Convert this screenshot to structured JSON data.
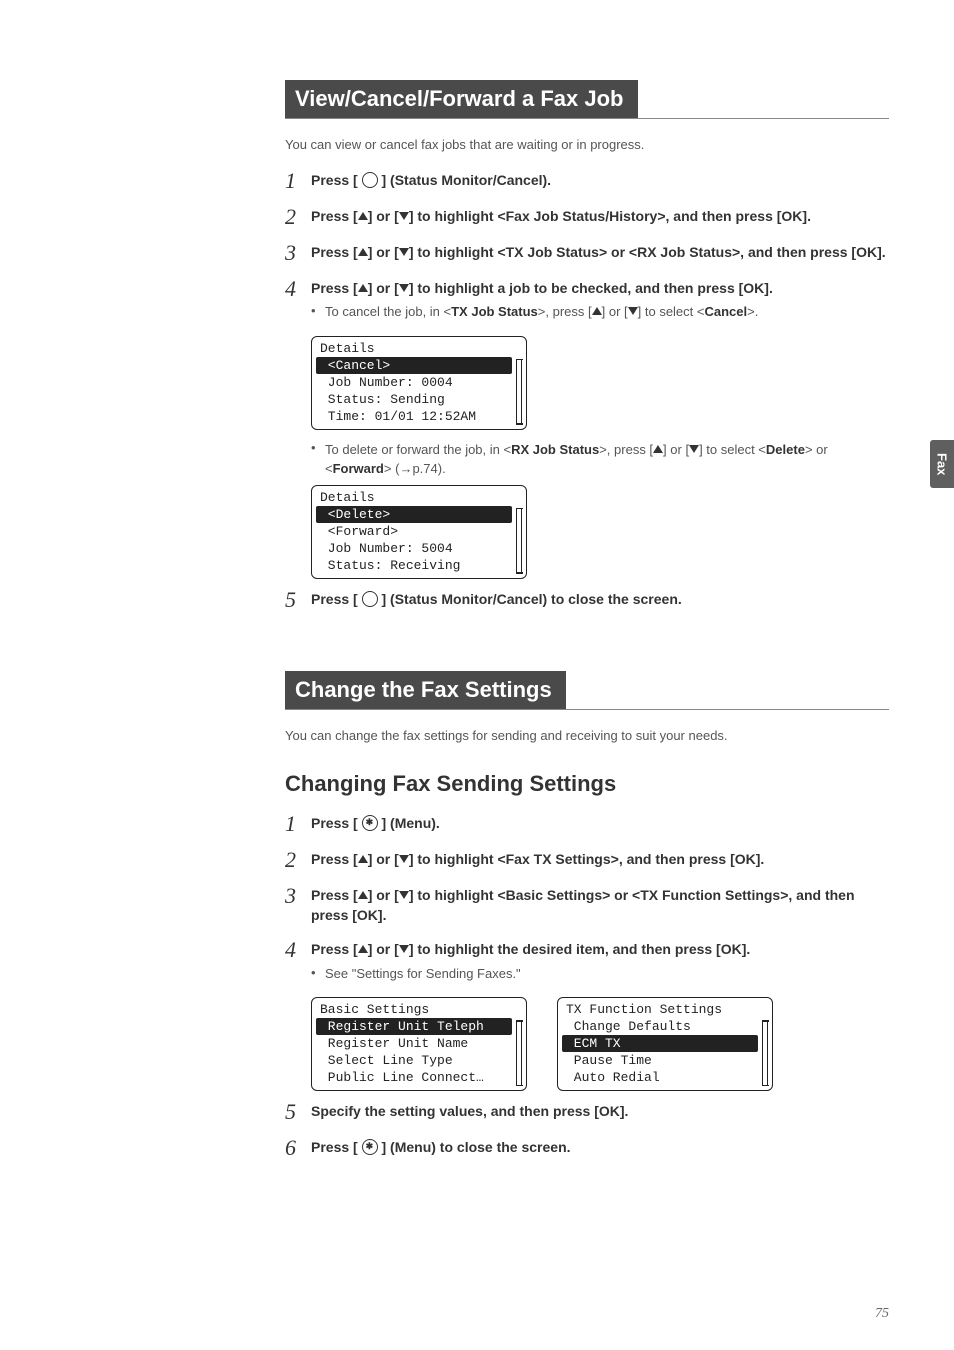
{
  "sideTab": "Fax",
  "pageNumber": "75",
  "section1": {
    "title": "View/Cancel/Forward a Fax Job",
    "intro": "You can view or cancel fax jobs that are waiting or in progress.",
    "steps": {
      "s1": {
        "num": "1",
        "a": "Press [",
        "b": "] (Status Monitor/Cancel)."
      },
      "s2": {
        "num": "2",
        "a": "Press [",
        "mid1": "] or [",
        "mid2": "] to highlight <Fax Job Status/History>, and then press [OK]."
      },
      "s3": {
        "num": "3",
        "a": "Press [",
        "mid1": "] or [",
        "mid2": "] to highlight <TX Job Status> or <RX Job Status>, and then press [OK]."
      },
      "s4": {
        "num": "4",
        "a": "Press [",
        "mid1": "] or [",
        "mid2": "] to highlight a job to be checked, and then press [OK].",
        "bullet1a": "To cancel the job, in <",
        "bullet1b": "TX Job Status",
        "bullet1c": ">, press [",
        "bullet1d": "] or [",
        "bullet1e": "] to select <",
        "bullet1f": "Cancel",
        "bullet1g": ">.",
        "bullet2a": "To delete or forward the job, in <",
        "bullet2b": "RX Job Status",
        "bullet2c": ">, press [",
        "bullet2d": "] or [",
        "bullet2e": "] to select <",
        "bullet2f": "Delete",
        "bullet2g": "> or <",
        "bullet2h": "Forward",
        "bullet2i": "> (",
        "bullet2j": "p.74)."
      },
      "s5": {
        "num": "5",
        "a": "Press [",
        "b": "] (Status Monitor/Cancel) to close the screen."
      }
    },
    "lcd1": {
      "title": "Details",
      "r1": " <Cancel>",
      "r2": " Job Number: 0004",
      "r3": " Status: Sending",
      "r4": " Time: 01/01 12:52AM"
    },
    "lcd2": {
      "title": "Details",
      "r1": " <Delete>",
      "r2": " <Forward>",
      "r3": " Job Number: 5004",
      "r4": " Status: Receiving"
    }
  },
  "section2": {
    "title": "Change the Fax Settings",
    "intro": "You can change the fax settings for sending and receiving to suit your needs.",
    "subheading": "Changing Fax Sending Settings",
    "steps": {
      "s1": {
        "num": "1",
        "a": "Press [",
        "b": "] (Menu)."
      },
      "s2": {
        "num": "2",
        "a": "Press [",
        "mid1": "] or [",
        "mid2": "] to highlight <Fax TX Settings>, and then press [OK]."
      },
      "s3": {
        "num": "3",
        "a": "Press [",
        "mid1": "] or [",
        "mid2": "] to highlight <Basic Settings> or <TX Function Settings>, and then press [OK]."
      },
      "s4": {
        "num": "4",
        "a": "Press [",
        "mid1": "] or [",
        "mid2": "] to highlight the desired item, and then press [OK].",
        "bullet": "See \"Settings for Sending Faxes.\""
      },
      "s5": {
        "num": "5",
        "text": "Specify the setting values, and then press [OK]."
      },
      "s6": {
        "num": "6",
        "a": "Press [",
        "b": "] (Menu) to close the screen."
      }
    },
    "lcdA": {
      "title": "Basic Settings",
      "r1": " Register Unit Teleph",
      "r2": " Register Unit Name",
      "r3": " Select Line Type",
      "r4": " Public Line Connect…"
    },
    "lcdB": {
      "title": "TX Function Settings",
      "r1": " Change Defaults",
      "r2": " ECM TX",
      "r3": " Pause Time",
      "r4": " Auto Redial"
    }
  }
}
